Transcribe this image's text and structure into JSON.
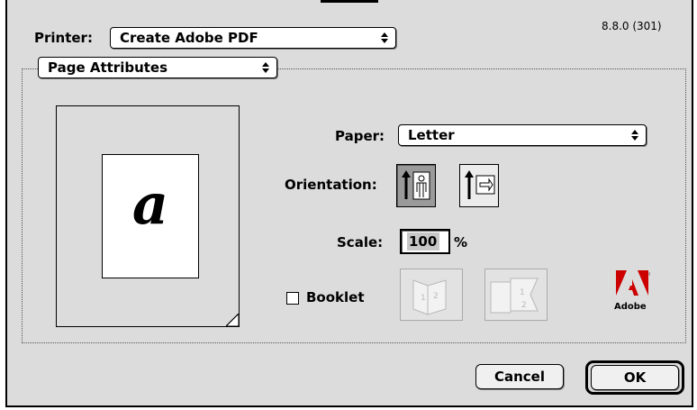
{
  "dialog": {
    "version": "8.8.0 (301)",
    "printer_label": "Printer:",
    "printer_value": "Create Adobe PDF",
    "section_value": "Page Attributes",
    "paper_label": "Paper:",
    "paper_value": "Letter",
    "orientation_label": "Orientation:",
    "scale_label": "Scale:",
    "scale_value": "100",
    "scale_unit": "%",
    "booklet_label": "Booklet",
    "booklet_checked": false,
    "preview_glyph": "a",
    "cancel_label": "Cancel",
    "ok_label": "OK",
    "brand": "Adobe",
    "brand_color": "#cc0000",
    "orientation_selected": "portrait"
  }
}
